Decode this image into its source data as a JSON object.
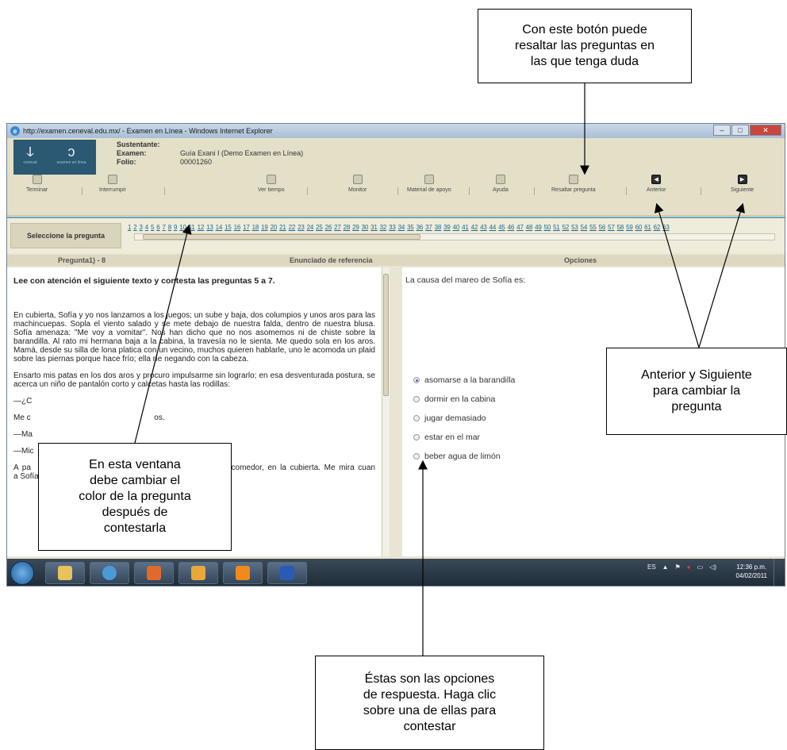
{
  "callouts": {
    "top": "Con este botón puede\nresaltar las preguntas en\nlas que tenga duda",
    "right": "Anterior y Siguiente\npara cambiar la\npregunta",
    "left": "En esta ventana\ndebe cambiar el\ncolor de la pregunta\ndespués de\ncontestarla",
    "bottom": "Éstas son las opciones\nde respuesta. Haga clic\nsobre una de ellas para\ncontestar"
  },
  "browser": {
    "title": "http://examen.ceneval.edu.mx/ - Examen en Línea - Windows Internet Explorer"
  },
  "header": {
    "labels": [
      "Sustentante:",
      "Examen:",
      "Folio:"
    ],
    "exam_value": "Guía Exani I (Demo Examen en Línea)",
    "folio_value": "00001260"
  },
  "toolbar": {
    "terminar": "Terminar",
    "interrumpir": "Interrumpir",
    "ver_tiempo": "Ver tiempo",
    "monitor": "Monitor",
    "material": "Material de apoyo",
    "ayuda": "Ayuda",
    "resaltar": "Resaltar pregunta",
    "anterior": "Anterior",
    "siguiente": "Siguiente"
  },
  "selector": {
    "label": "Seleccione la pregunta",
    "question_numbers": [
      "1",
      "2",
      "3",
      "4",
      "5",
      "6",
      "7",
      "8",
      "9",
      "10",
      "11",
      "12",
      "13",
      "14",
      "15",
      "16",
      "17",
      "18",
      "19",
      "20",
      "21",
      "22",
      "23",
      "24",
      "25",
      "26",
      "27",
      "28",
      "29",
      "30",
      "31",
      "32",
      "33",
      "34",
      "35",
      "36",
      "37",
      "38",
      "39",
      "40",
      "41",
      "42",
      "43",
      "44",
      "45",
      "46",
      "47",
      "48",
      "49",
      "50",
      "51",
      "52",
      "53",
      "54",
      "55",
      "56",
      "57",
      "58",
      "59",
      "60",
      "61",
      "62",
      "63"
    ]
  },
  "columns": {
    "question": "Pregunta1) - 8",
    "reference": "Enunciado de referencia",
    "options": "Opciones"
  },
  "reading": {
    "heading": "Lee con atención el siguiente texto y contesta las preguntas  5 a 7.",
    "p1": "En cubierta, Sofía y yo nos lanzamos a los juegos; un sube y baja, dos columpios y unos aros para las machincuepas. Sopla el viento salado y se mete debajo de nuestra falda, dentro de nuestra blusa. Sofía amenaza: \"Me voy a vomitar\". Nos han dicho que no nos asomemos ni de chiste sobre la barandilla. Al rato mi hermana baja a la cabina, la travesía no le sienta. Me quedo sola en los aros. Mamá, desde su silla de lona platica con un vecino, muchos quieren hablarle, uno le acomoda un plaid sobre las piernas porque hace frío; ella ríe negando con la cabeza.",
    "p2": "Ensarto mis patas en los dos aros y procuro impulsarme sin lograrlo; en esa desventurada postura, se acerca un niño de pantalón corto y calcetas hasta las rodillas:",
    "p3": "—¿C",
    "p4": "Me c                                                        os.",
    "p5": "—Ma",
    "p6": "—Mic",
    "p7": "A pa                                                      comedor, en la cubierta. Me mira cuan                                                   a Sofía a la que siguen, por sus"
  },
  "question": {
    "prompt": "La causa del mareo de Sofía es:",
    "options": [
      "asomarse a la barandilla",
      "dormir en la cabina",
      "jugar demasiado",
      "estar en el mar",
      "beber agua de limón"
    ],
    "selected_index": 0
  },
  "taskbar": {
    "lang": "ES",
    "time": "12:36 p.m.",
    "date": "04/02/2011"
  }
}
